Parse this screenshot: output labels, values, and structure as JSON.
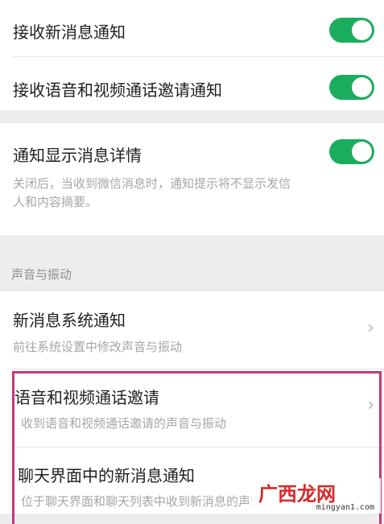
{
  "settings": {
    "receive_new_message": {
      "label": "接收新消息通知",
      "enabled": true
    },
    "receive_call_invite": {
      "label": "接收语音和视频通话邀请通知",
      "enabled": true
    },
    "show_details": {
      "label": "通知显示消息详情",
      "enabled": true,
      "description_line1": "关闭后，当收到微信消息时，通知提示将不显示发信",
      "description_line2": "人和内容摘要。"
    }
  },
  "sound_section": {
    "header": "声音与振动",
    "items": [
      {
        "title": "新消息系统通知",
        "subtitle": "前往系统设置中修改声音与振动"
      },
      {
        "title": "语音和视频通话邀请",
        "subtitle": "收到语音和视频通话邀请的声音与振动"
      },
      {
        "title": "聊天界面中的新消息通知",
        "subtitle": "位于聊天界面和聊天列表中收到新消息的声音"
      }
    ]
  },
  "colors": {
    "toggle_on": "#1aad5e",
    "highlight_border": "#c0397a"
  },
  "watermark": {
    "logo": "广西龙网",
    "site": "mingyan1.com"
  }
}
